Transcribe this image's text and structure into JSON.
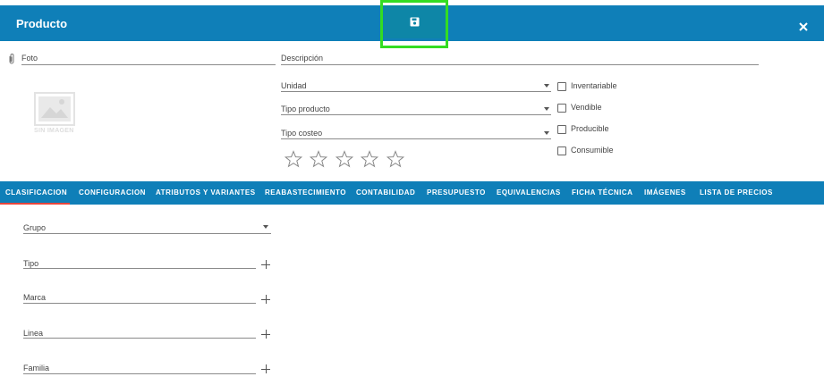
{
  "header": {
    "title": "Producto",
    "accent_color": "#0f7fb8",
    "save_icon": "save-icon",
    "close_icon": "close-icon"
  },
  "photo": {
    "attach_icon": "paperclip-icon",
    "label": "Foto",
    "placeholder_text": "SIN IMAGEN"
  },
  "form": {
    "descripcion": {
      "label": "Descripción",
      "value": ""
    },
    "unidad": {
      "label": "Unidad",
      "value": ""
    },
    "tipo_producto": {
      "label": "Tipo producto",
      "value": ""
    },
    "tipo_costeo": {
      "label": "Tipo costeo",
      "value": ""
    },
    "rating": {
      "max": 5,
      "value": 0
    }
  },
  "checkboxes": [
    {
      "label": "Inventariable",
      "checked": false
    },
    {
      "label": "Vendible",
      "checked": false
    },
    {
      "label": "Producible",
      "checked": false
    },
    {
      "label": "Consumible",
      "checked": false
    }
  ],
  "tabs": [
    {
      "label": "CLASIFICACION",
      "active": true
    },
    {
      "label": "CONFIGURACION",
      "active": false
    },
    {
      "label": "ATRIBUTOS Y VARIANTES",
      "active": false
    },
    {
      "label": "REABASTECIMIENTO",
      "active": false
    },
    {
      "label": "CONTABILIDAD",
      "active": false
    },
    {
      "label": "PRESUPUESTO",
      "active": false
    },
    {
      "label": "EQUIVALENCIAS",
      "active": false
    },
    {
      "label": "FICHA TÉCNICA",
      "active": false
    },
    {
      "label": "IMÁGENES",
      "active": false
    },
    {
      "label": "LISTA DE PRECIOS",
      "active": false
    }
  ],
  "clasificacion": {
    "grupo": {
      "label": "Grupo",
      "value": ""
    },
    "tipo": {
      "label": "Tipo",
      "value": ""
    },
    "marca": {
      "label": "Marca",
      "value": ""
    },
    "linea": {
      "label": "Linea",
      "value": ""
    },
    "familia": {
      "label": "Familia",
      "value": ""
    }
  }
}
